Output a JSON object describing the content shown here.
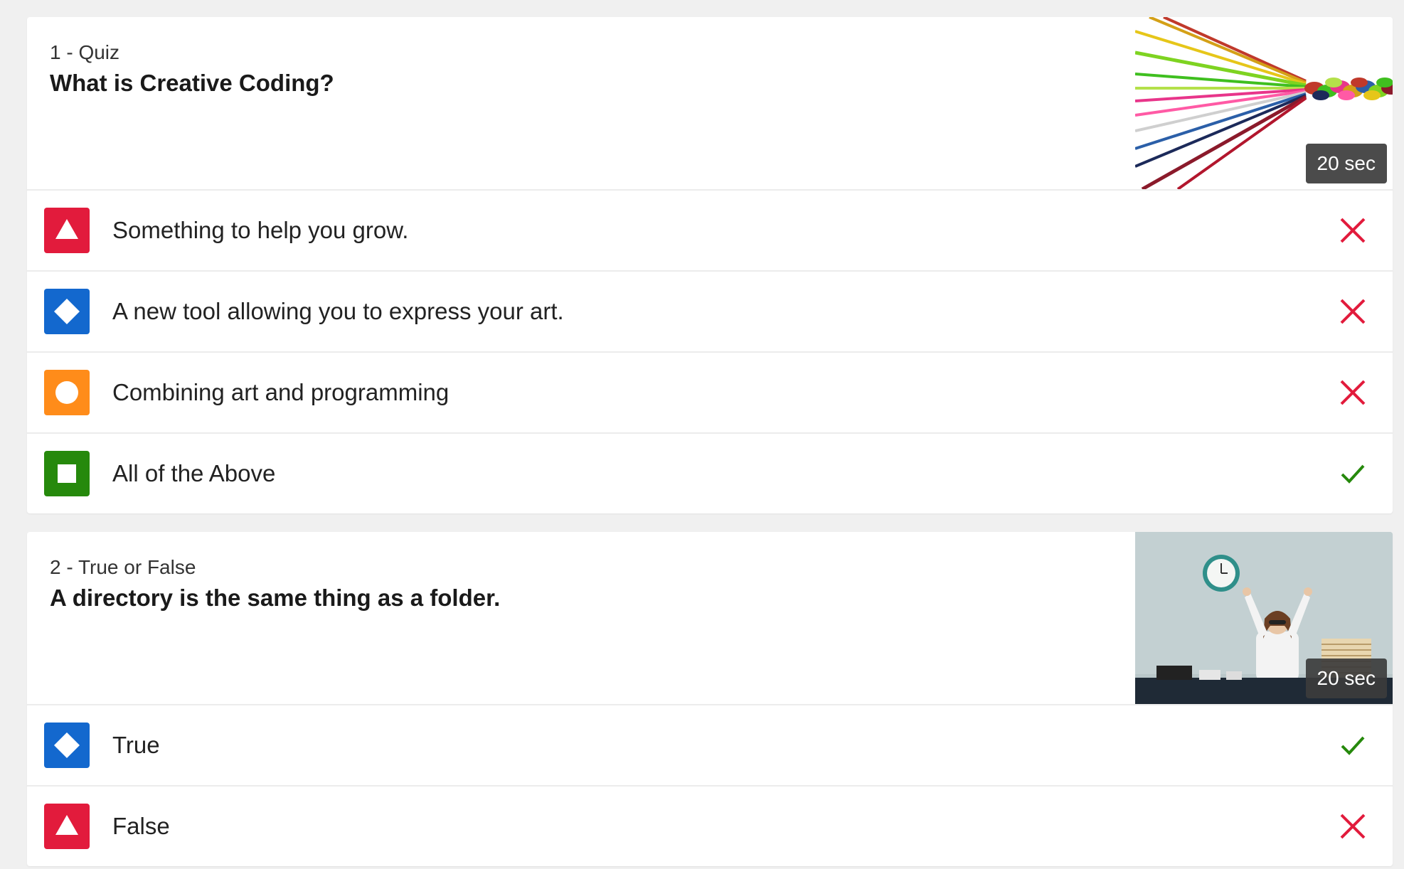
{
  "colors": {
    "red": "#e21b3c",
    "blue": "#1368ce",
    "yellow": "#ff8c1a",
    "green": "#26890c",
    "wrong": "#e21b3c",
    "correct": "#26890c"
  },
  "questions": [
    {
      "type_label": "1 - Quiz",
      "title": "What is Creative Coding?",
      "time": "20 sec",
      "image": "braided-threads-image",
      "answers": [
        {
          "shape": "triangle-icon",
          "color": "red",
          "text": "Something to help you grow.",
          "correct": false
        },
        {
          "shape": "diamond-icon",
          "color": "blue",
          "text": "A new tool allowing you to express your art.",
          "correct": false
        },
        {
          "shape": "circle-icon",
          "color": "yellow",
          "text": "Combining art and programming",
          "correct": false
        },
        {
          "shape": "square-icon",
          "color": "green",
          "text": "All of the Above",
          "correct": true
        }
      ]
    },
    {
      "type_label": "2 - True or False",
      "title": "A directory is the same thing as a folder.",
      "time": "20 sec",
      "image": "girl-at-desk-image",
      "answers": [
        {
          "shape": "diamond-icon",
          "color": "blue",
          "text": "True",
          "correct": true
        },
        {
          "shape": "triangle-icon",
          "color": "red",
          "text": "False",
          "correct": false
        }
      ]
    }
  ]
}
